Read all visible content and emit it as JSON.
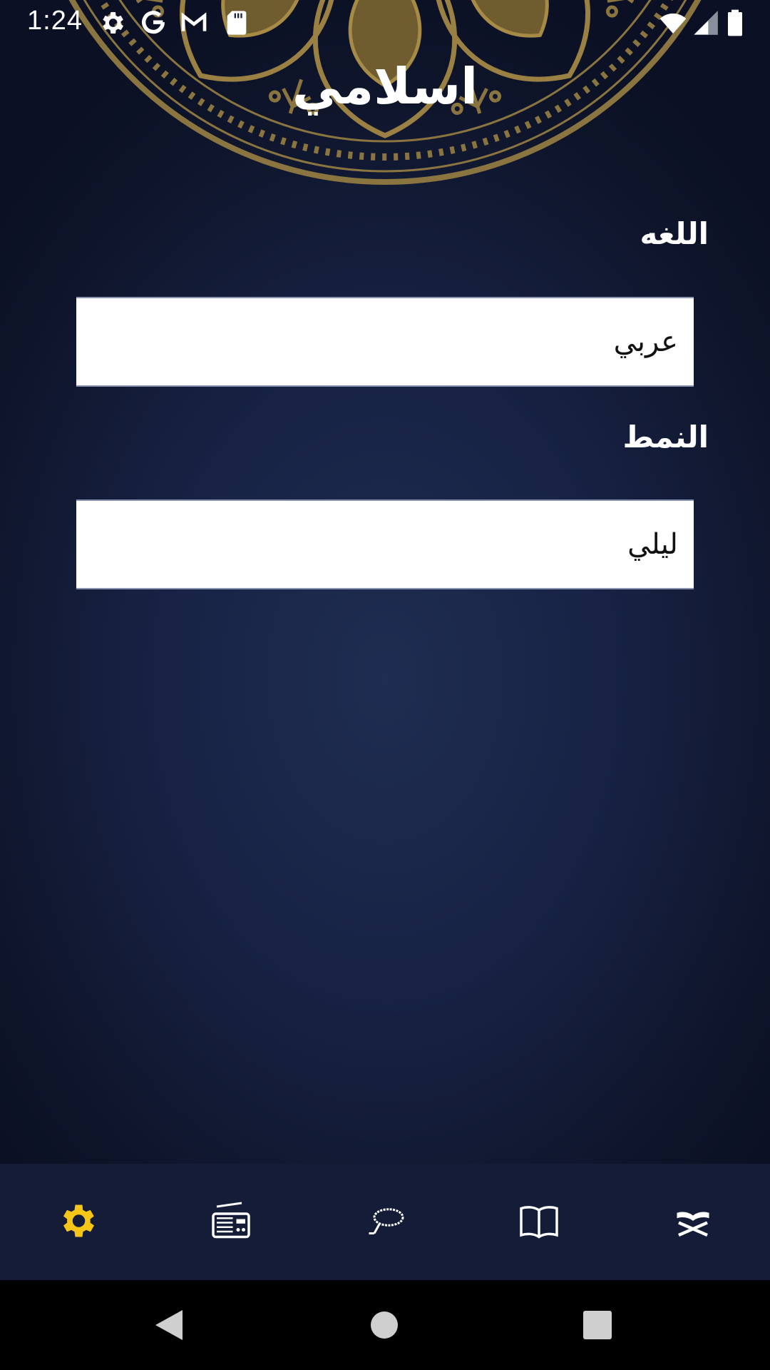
{
  "status_bar": {
    "time": "1:24",
    "icons": [
      "settings-icon",
      "google-icon",
      "gmail-icon",
      "sd-card-icon",
      "wifi-icon",
      "signal-icon",
      "battery-icon"
    ]
  },
  "header": {
    "title": "اسلامي"
  },
  "settings": {
    "language_label": "اللغه",
    "language_value": "عربي",
    "theme_label": "النمط",
    "theme_value": "ليلي"
  },
  "bottom_nav": {
    "items": [
      {
        "icon": "settings-icon",
        "active": true
      },
      {
        "icon": "radio-icon",
        "active": false
      },
      {
        "icon": "tasbeeh-icon",
        "active": false
      },
      {
        "icon": "book-icon",
        "active": false
      },
      {
        "icon": "quran-icon",
        "active": false
      }
    ],
    "active_color": "#f5c518",
    "inactive_color": "#ffffff"
  },
  "system_nav": {
    "icons": [
      "back-icon",
      "home-icon",
      "recents-icon"
    ]
  },
  "colors": {
    "background": "#1a2547",
    "accent_gold": "#a8893f",
    "nav_background": "#141c37"
  }
}
